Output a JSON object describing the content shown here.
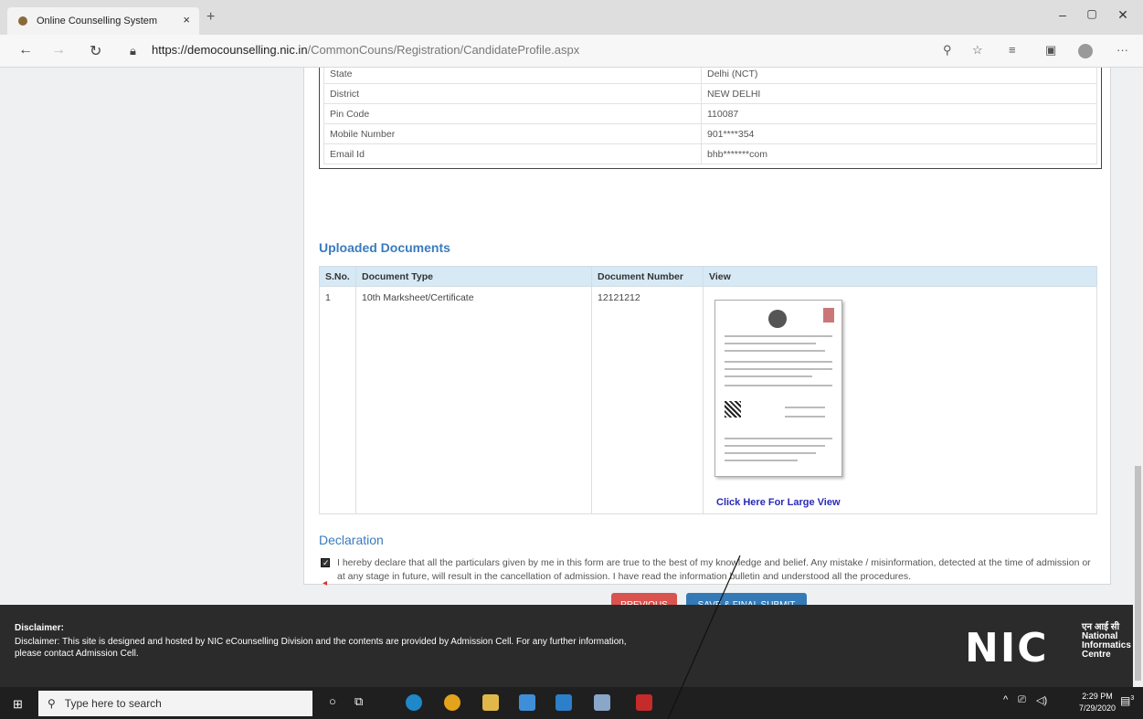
{
  "browser": {
    "tab_title": "Online Counselling System",
    "tab_close": "×",
    "new_tab": "+",
    "url_host": "https://democounselling.nic.in",
    "url_path": "/CommonCouns/Registration/CandidateProfile.aspx",
    "minimize": "–",
    "maximize": "▢",
    "close": "✕"
  },
  "address": {
    "rows": [
      {
        "label": "State",
        "value": "Delhi (NCT)"
      },
      {
        "label": "District",
        "value": "NEW DELHI"
      },
      {
        "label": "Pin Code",
        "value": "110087"
      },
      {
        "label": "Mobile Number",
        "value": "901****354"
      },
      {
        "label": "Email Id",
        "value": "bhb*******com"
      }
    ]
  },
  "documents": {
    "title": "Uploaded Documents",
    "headers": [
      "S.No.",
      "Document Type",
      "Document Number",
      "View"
    ],
    "rows": [
      {
        "sno": "1",
        "type": "10th Marksheet/Certificate",
        "number": "12121212",
        "link": "Click Here For Large View"
      }
    ]
  },
  "declaration": {
    "title": "Declaration",
    "text": "I hereby declare that all the particulars given by me in this form are true to the best of my knowledge and belief. Any mistake / misinformation, detected at the time of admission or at any stage in future, will result in the cancellation of admission. I have read the information bulletin and understood all the procedures.",
    "checked": true
  },
  "buttons": {
    "previous": "PREVIOUS",
    "save": "SAVE & FINAL SUBMIT"
  },
  "footer": {
    "title": "Disclaimer:",
    "text": "Disclaimer: This site is designed and hosted by NIC eCounselling Division and the contents are provided by Admission Cell. For any further information, please contact Admission Cell.",
    "logo_big": "NIC",
    "logo_hindi": "एन आई सी",
    "logo_line1": "National",
    "logo_line2": "Informatics",
    "logo_line3": "Centre"
  },
  "taskbar": {
    "search_placeholder": "Type here to search",
    "time": "2:29 PM",
    "date": "7/29/2020",
    "notification_count": "3"
  },
  "colors": {
    "section_title": "#3a7bbf",
    "previous_btn": "#d9534f",
    "save_btn": "#337ab7",
    "footer_bg": "#2b2b2b",
    "table_header_bg": "#d6e9f5"
  }
}
